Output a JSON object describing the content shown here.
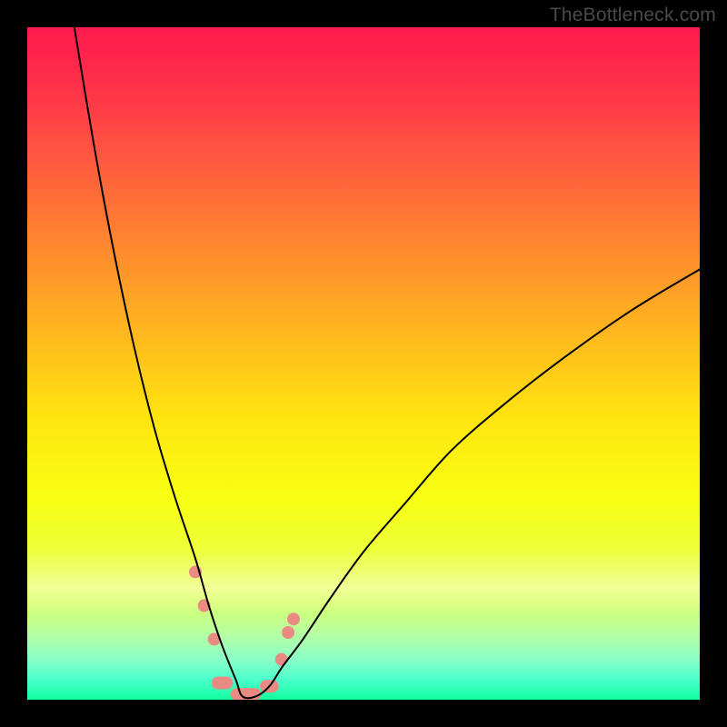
{
  "watermark": "TheBottleneck.com",
  "chart_data": {
    "type": "line",
    "title": "",
    "xlabel": "",
    "ylabel": "",
    "xlim": [
      0,
      100
    ],
    "ylim": [
      0,
      100
    ],
    "grid": false,
    "legend": false,
    "background": {
      "type": "vertical-gradient",
      "description": "Red (top) through orange, yellow, to green (bottom). Represents bottleneck severity: red = high bottleneck, green = balanced.",
      "stops": [
        {
          "pos": 0.0,
          "color": "#ff1a4d"
        },
        {
          "pos": 0.2,
          "color": "#ff5a3f"
        },
        {
          "pos": 0.46,
          "color": "#ffb91e"
        },
        {
          "pos": 0.7,
          "color": "#f8ff12"
        },
        {
          "pos": 0.9,
          "color": "#b8ffa0"
        },
        {
          "pos": 1.0,
          "color": "#10ff9f"
        }
      ]
    },
    "series": [
      {
        "name": "bottleneck-curve",
        "description": "V-shaped curve; minimum near x≈32 where bottleneck ≈ 0%. Left branch rises steeply to 100% at x≈7; right branch rises gently to ~64% at x=100.",
        "color": "#000000",
        "x": [
          7,
          10,
          13,
          16,
          19,
          22,
          25,
          27,
          29,
          31,
          32,
          34,
          36,
          38,
          41,
          45,
          50,
          56,
          63,
          71,
          80,
          90,
          100
        ],
        "y": [
          100,
          82,
          66,
          52,
          40,
          30,
          21,
          14,
          8,
          3,
          0.5,
          0.5,
          2,
          5,
          9,
          15,
          22,
          29,
          37,
          44,
          51,
          58,
          64
        ]
      }
    ],
    "markers": {
      "description": "Salmon-colored rounded markers clustered near the curve minimum (the optimal/balanced region).",
      "color": "#e98b82",
      "points": [
        {
          "x": 25.0,
          "y": 19
        },
        {
          "x": 26.3,
          "y": 14
        },
        {
          "x": 27.8,
          "y": 9
        },
        {
          "x": 29.0,
          "y": 2.5,
          "w": 3.2
        },
        {
          "x": 32.5,
          "y": 0.8,
          "w": 4.5
        },
        {
          "x": 36.0,
          "y": 2.0,
          "w": 2.8
        },
        {
          "x": 37.8,
          "y": 6
        },
        {
          "x": 38.8,
          "y": 10
        },
        {
          "x": 39.6,
          "y": 12
        }
      ]
    }
  }
}
